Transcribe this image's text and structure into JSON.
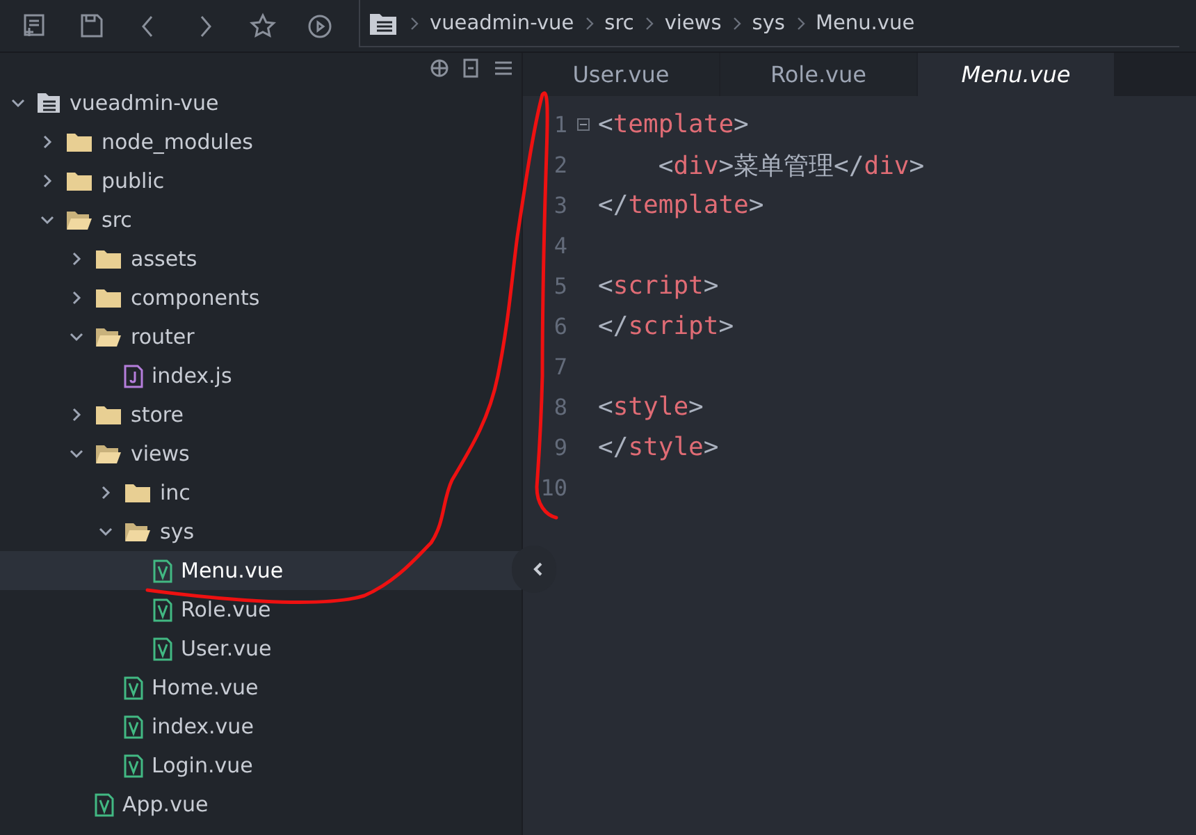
{
  "toolbar": {
    "buttons": [
      {
        "kind": "new"
      },
      {
        "kind": "save"
      },
      {
        "kind": "back"
      },
      {
        "kind": "forward"
      },
      {
        "kind": "star"
      },
      {
        "kind": "run"
      }
    ],
    "breadcrumb": [
      "vueadmin-vue",
      "src",
      "views",
      "sys",
      "Menu.vue"
    ]
  },
  "sidebar": {
    "tree": [
      {
        "name": "vueadmin-vue",
        "kind": "project",
        "expanded": true,
        "selected": false,
        "children": [
          {
            "name": "node_modules",
            "kind": "folder",
            "expanded": false,
            "selected": false
          },
          {
            "name": "public",
            "kind": "folder",
            "expanded": false,
            "selected": false
          },
          {
            "name": "src",
            "kind": "folder",
            "expanded": true,
            "selected": false,
            "children": [
              {
                "name": "assets",
                "kind": "folder",
                "expanded": false,
                "selected": false
              },
              {
                "name": "components",
                "kind": "folder",
                "expanded": false,
                "selected": false
              },
              {
                "name": "router",
                "kind": "folder",
                "expanded": true,
                "selected": false,
                "children": [
                  {
                    "name": "index.js",
                    "kind": "js",
                    "selected": false
                  }
                ]
              },
              {
                "name": "store",
                "kind": "folder",
                "expanded": false,
                "selected": false
              },
              {
                "name": "views",
                "kind": "folder",
                "expanded": true,
                "selected": false,
                "children": [
                  {
                    "name": "inc",
                    "kind": "folder",
                    "expanded": false,
                    "selected": false
                  },
                  {
                    "name": "sys",
                    "kind": "folder",
                    "expanded": true,
                    "selected": false,
                    "children": [
                      {
                        "name": "Menu.vue",
                        "kind": "vue",
                        "selected": true
                      },
                      {
                        "name": "Role.vue",
                        "kind": "vue",
                        "selected": false
                      },
                      {
                        "name": "User.vue",
                        "kind": "vue",
                        "selected": false
                      }
                    ]
                  },
                  {
                    "name": "Home.vue",
                    "kind": "vue",
                    "selected": false
                  },
                  {
                    "name": "index.vue",
                    "kind": "vue",
                    "selected": false
                  },
                  {
                    "name": "Login.vue",
                    "kind": "vue",
                    "selected": false
                  }
                ]
              },
              {
                "name": "App.vue",
                "kind": "vue",
                "selected": false
              }
            ]
          }
        ]
      }
    ]
  },
  "editor": {
    "tabs": [
      {
        "label": "User.vue",
        "selected": false
      },
      {
        "label": "Role.vue",
        "selected": false
      },
      {
        "label": "Menu.vue",
        "selected": true
      }
    ],
    "lines": [
      {
        "number": "1",
        "fold": true,
        "tokens": [
          {
            "kind": "punct",
            "text": "<"
          },
          {
            "kind": "tag",
            "text": "template"
          },
          {
            "kind": "punct",
            "text": ">"
          }
        ]
      },
      {
        "number": "2",
        "fold": false,
        "tokens": [
          {
            "kind": "punct",
            "text": "    <"
          },
          {
            "kind": "tag",
            "text": "div"
          },
          {
            "kind": "punct",
            "text": ">"
          },
          {
            "kind": "text",
            "text": "菜单管理"
          },
          {
            "kind": "punct",
            "text": "</"
          },
          {
            "kind": "tag",
            "text": "div"
          },
          {
            "kind": "punct",
            "text": ">"
          }
        ]
      },
      {
        "number": "3",
        "fold": false,
        "tokens": [
          {
            "kind": "punct",
            "text": "</"
          },
          {
            "kind": "tag",
            "text": "template"
          },
          {
            "kind": "punct",
            "text": ">"
          }
        ]
      },
      {
        "number": "4",
        "fold": false
      },
      {
        "number": "5",
        "fold": false,
        "tokens": [
          {
            "kind": "punct",
            "text": "<"
          },
          {
            "kind": "tag",
            "text": "script"
          },
          {
            "kind": "punct",
            "text": ">"
          }
        ]
      },
      {
        "number": "6",
        "fold": false,
        "tokens": [
          {
            "kind": "punct",
            "text": "</"
          },
          {
            "kind": "tag",
            "text": "script"
          },
          {
            "kind": "punct",
            "text": ">"
          }
        ]
      },
      {
        "number": "7",
        "fold": false
      },
      {
        "number": "8",
        "fold": false,
        "tokens": [
          {
            "kind": "punct",
            "text": "<"
          },
          {
            "kind": "tag",
            "text": "style"
          },
          {
            "kind": "punct",
            "text": ">"
          }
        ]
      },
      {
        "number": "9",
        "fold": false,
        "tokens": [
          {
            "kind": "punct",
            "text": "</"
          },
          {
            "kind": "tag",
            "text": "style"
          },
          {
            "kind": "punct",
            "text": ">"
          }
        ]
      },
      {
        "number": "10",
        "fold": false
      }
    ]
  }
}
